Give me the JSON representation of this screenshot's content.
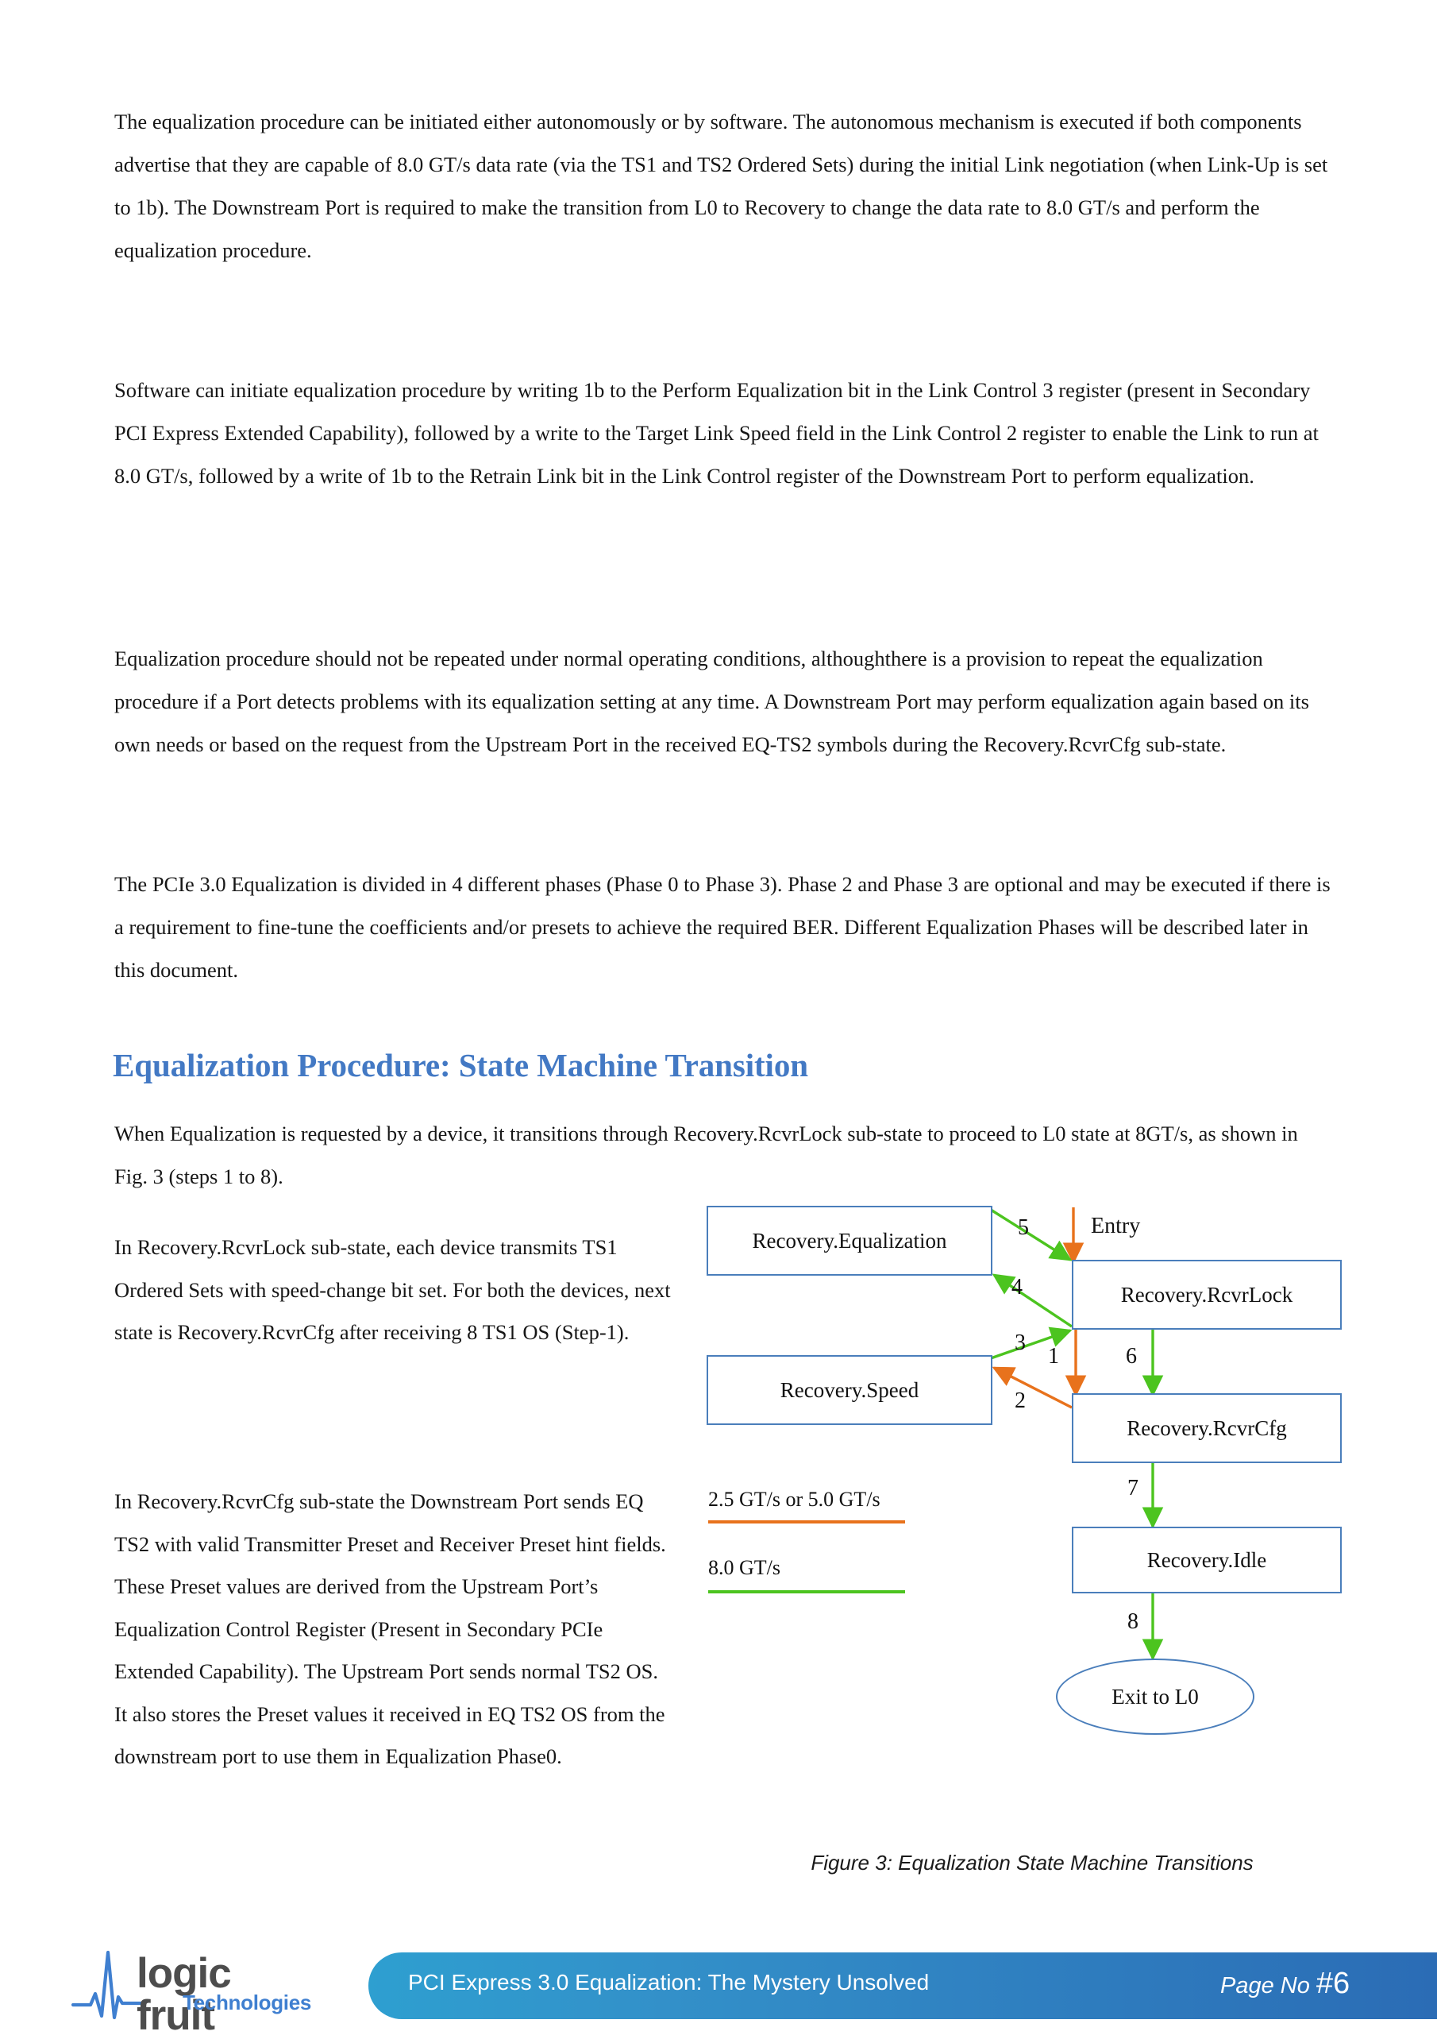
{
  "body": {
    "paragraphs": [
      "The equalization procedure can be initiated either autonomously or by software. The autonomous mechanism is executed if both components advertise that they are capable of 8.0 GT/s data rate (via the TS1 and TS2 Ordered Sets) during the initial Link negotiation (when Link-Up is set to 1b). The Downstream Port is required to make the transition from L0 to Recovery to change the data rate to 8.0 GT/s and perform the equalization procedure.",
      "Software can initiate equalization procedure by writing 1b to the Perform Equalization bit in the Link Control 3 register (present in Secondary PCI Express Extended Capability), followed by a write to the Target Link Speed field in the Link Control 2 register to enable the Link to run at 8.0 GT/s, followed by a write of 1b to the Retrain Link bit in the Link Control register of the Downstream Port to perform equalization.",
      "Equalization procedure should not be repeated under normal operating conditions, althoughthere is a provision to repeat the equalization procedure if a Port detects problems with its equalization setting at any time. A Downstream Port may perform equalization again based on its own needs or based on the request from the Upstream Port in the received EQ-TS2 symbols during the Recovery.RcvrCfg sub-state.",
      "The PCIe 3.0 Equalization is divided in 4 different phases (Phase 0 to Phase 3). Phase 2 and Phase 3 are optional and may be executed if there is a requirement to fine-tune the coefficients and/or presets to achieve the required BER. Different Equalization Phases will be described later in this document."
    ],
    "heading": "Equalization Procedure: State Machine Transition",
    "heading_color": "#4379c4",
    "after_heading": "When Equalization is requested by a device, it transitions through Recovery.RcvrLock sub-state to proceed to L0 state at 8GT/s, as shown in Fig. 3 (steps 1 to 8).",
    "left_column": [
      "In Recovery.RcvrLock sub-state, each device transmits TS1 Ordered Sets with speed-change bit set. For both the devices, next state is Recovery.RcvrCfg after receiving 8 TS1 OS (Step-1).",
      "In Recovery.RcvrCfg sub-state the Downstream Port sends EQ TS2 with valid Transmitter Preset and Receiver Preset hint fields. These Preset values are derived from the Upstream Port’s Equalization Control Register (Present in Secondary PCIe Extended Capability). The Upstream Port sends normal TS2 OS. It also stores the Preset values it received in EQ TS2 OS from the downstream port to use them in Equalization Phase0."
    ]
  },
  "figure": {
    "caption": "Figure 3: Equalization State Machine Transitions",
    "colors": {
      "node_border": "#4a7ebb",
      "orange": "#e8721c",
      "green": "#4cc41f"
    },
    "nodes": [
      {
        "id": "equalization",
        "label": "Recovery.Equalization",
        "shape": "rect"
      },
      {
        "id": "speed",
        "label": "Recovery.Speed",
        "shape": "rect"
      },
      {
        "id": "rcvrlock",
        "label": "Recovery.RcvrLock",
        "shape": "rect"
      },
      {
        "id": "rcvrcfg",
        "label": "Recovery.RcvrCfg",
        "shape": "rect"
      },
      {
        "id": "idle",
        "label": "Recovery.Idle",
        "shape": "rect"
      },
      {
        "id": "exit",
        "label": "Exit to L0",
        "shape": "ellipse"
      }
    ],
    "entry_label": "Entry",
    "edges": [
      {
        "step": "1",
        "from": "rcvrlock",
        "to": "rcvrcfg",
        "color": "orange"
      },
      {
        "step": "2",
        "from": "rcvrcfg",
        "to": "speed",
        "color": "orange"
      },
      {
        "step": "3",
        "from": "speed",
        "to": "rcvrlock",
        "color": "green"
      },
      {
        "step": "4",
        "from": "rcvrlock",
        "to": "equalization",
        "color": "green"
      },
      {
        "step": "5",
        "from": "equalization",
        "to": "rcvrlock",
        "color": "green"
      },
      {
        "step": "6",
        "from": "rcvrlock",
        "to": "rcvrcfg",
        "color": "green"
      },
      {
        "step": "7",
        "from": "rcvrcfg",
        "to": "idle",
        "color": "green"
      },
      {
        "step": "8",
        "from": "idle",
        "to": "exit",
        "color": "green"
      }
    ],
    "legend": [
      {
        "label": "2.5 GT/s or 5.0 GT/s",
        "color": "#e8721c"
      },
      {
        "label": "8.0 GT/s",
        "color": "#4cc41f"
      }
    ]
  },
  "footer": {
    "logo_word": "logic fruit",
    "logo_sub": "Technologies",
    "title": "PCI Express 3.0 Equalization: The Mystery Unsolved",
    "page_prefix": "Page No",
    "page_number": "#6",
    "bar_color_left": "#2e9fd0",
    "bar_color_right": "#2b6cb5"
  }
}
